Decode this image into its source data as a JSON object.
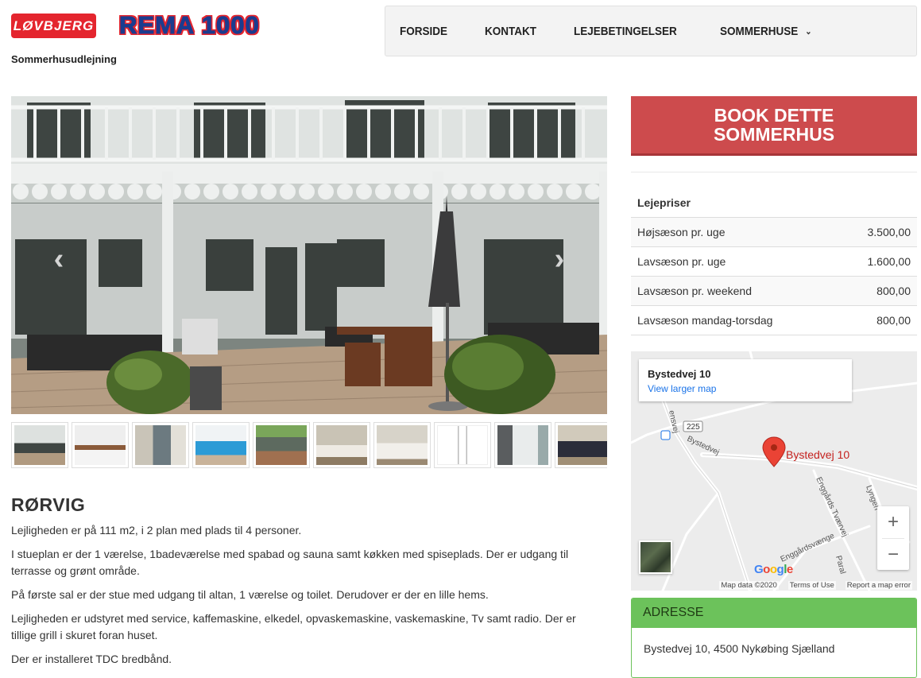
{
  "header": {
    "logo_lovbjerg": "LØVBJERG",
    "logo_rema": "REMA 1000",
    "subtitle": "Sommerhusudlejning"
  },
  "nav": {
    "items": [
      {
        "label": "FORSIDE"
      },
      {
        "label": "KONTAKT"
      },
      {
        "label": "LEJEBETINGELSER"
      },
      {
        "label": "SOMMERHUSE"
      }
    ]
  },
  "gallery": {
    "prev_icon": "chevron-left-icon",
    "next_icon": "chevron-right-icon",
    "thumbnail_count": 10
  },
  "listing": {
    "title": "RØRVIG",
    "paragraphs": [
      "Lejligheden er på 111 m2, i 2 plan med plads til 4 personer.",
      "I stueplan er der 1 værelse, 1badeværelse med spabad og sauna samt køkken med spiseplads. Der er udgang til terrasse og grønt område.",
      "På første sal er der stue med udgang til altan, 1 værelse og toilet. Derudover er der en lille hems.",
      "Lejligheden er udstyret med service, kaffemaskine, elkedel, opvaskemaskine, vaskemaskine, Tv samt radio. Der er tillige grill i skuret foran huset.",
      "Der er installeret TDC bredbånd."
    ]
  },
  "booking": {
    "button_label": "BOOK DETTE SOMMERHUS"
  },
  "prices": {
    "heading": "Lejepriser",
    "rows": [
      {
        "label": "Højsæson pr. uge",
        "value": "3.500,00"
      },
      {
        "label": "Lavsæson pr. uge",
        "value": "1.600,00"
      },
      {
        "label": "Lavsæson pr. weekend",
        "value": "800,00"
      },
      {
        "label": "Lavsæson mandag-torsdag",
        "value": "800,00"
      }
    ]
  },
  "map": {
    "place_title": "Bystedvej 10",
    "larger_map_link": "View larger map",
    "pin_label": "Bystedvej 10",
    "road_labels": [
      "Bystedvej",
      "Enggårds Tværvej",
      "Enggårdsvænge",
      "Lyngen",
      "Paral",
      "225",
      "ensvej"
    ],
    "zoom_in": "+",
    "zoom_out": "−",
    "google_logo": "Google",
    "footer": {
      "map_data": "Map data ©2020",
      "terms": "Terms of Use",
      "report": "Report a map error"
    },
    "pin_color": "#ea4335"
  },
  "address": {
    "heading": "ADRESSE",
    "text": "Bystedvej 10, 4500 Nykøbing Sjælland",
    "accent_color": "#6cc25b"
  },
  "colors": {
    "book_button": "#cd4b4d",
    "nav_bg": "#f3f3f3",
    "link": "#1a73e8"
  }
}
